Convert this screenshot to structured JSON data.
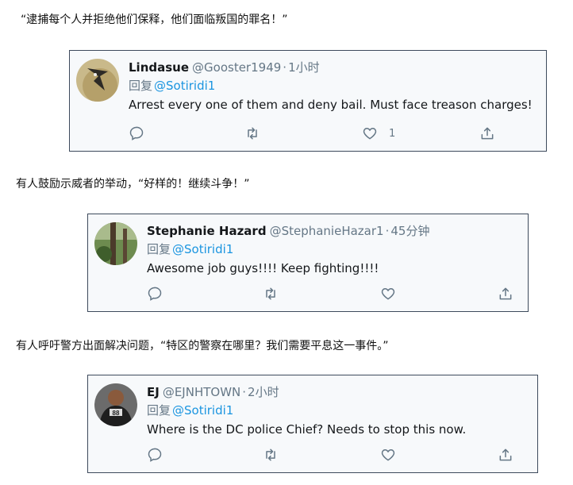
{
  "captions": [
    "“逮捕每个人并拒绝他们保释，他们面临叛国的罪名！”",
    "有人鼓励示威者的举动，“好样的！继续斗争！”",
    "有人呼吁警方出面解决问题，“特区的警察在哪里？我们需要平息这一事件。”"
  ],
  "tweets": [
    {
      "name": "Lindasue",
      "handle": "@Gooster1949",
      "dot": "·",
      "time": "1小时",
      "reply_prefix": "回复",
      "reply_to": "@Sotiridi1",
      "text": "Arrest every one of them and deny bail.  Must face treason charges!",
      "like_count": "1",
      "icons": [
        "reply-icon",
        "retweet-icon",
        "like-icon",
        "share-icon"
      ]
    },
    {
      "name": "Stephanie Hazard",
      "handle": "@StephanieHazar1",
      "dot": "·",
      "time": "45分钟",
      "reply_prefix": "回复",
      "reply_to": "@Sotiridi1",
      "text": "Awesome job guys!!!! Keep fighting!!!!",
      "like_count": "",
      "icons": [
        "reply-icon",
        "retweet-icon",
        "like-icon",
        "share-icon"
      ]
    },
    {
      "name": "EJ",
      "handle": "@EJNHTOWN",
      "dot": "·",
      "time": "2小时",
      "reply_prefix": "回复",
      "reply_to": "@Sotiridi1",
      "text": "Where is the DC police Chief?  Needs to stop this now.",
      "like_count": "",
      "icons": [
        "reply-icon",
        "retweet-icon",
        "like-icon",
        "share-icon"
      ]
    }
  ],
  "colors": {
    "link": "#1b95e0",
    "muted": "#657786",
    "card_border": "#3d4a5c",
    "card_bg": "#f7f9fb"
  }
}
